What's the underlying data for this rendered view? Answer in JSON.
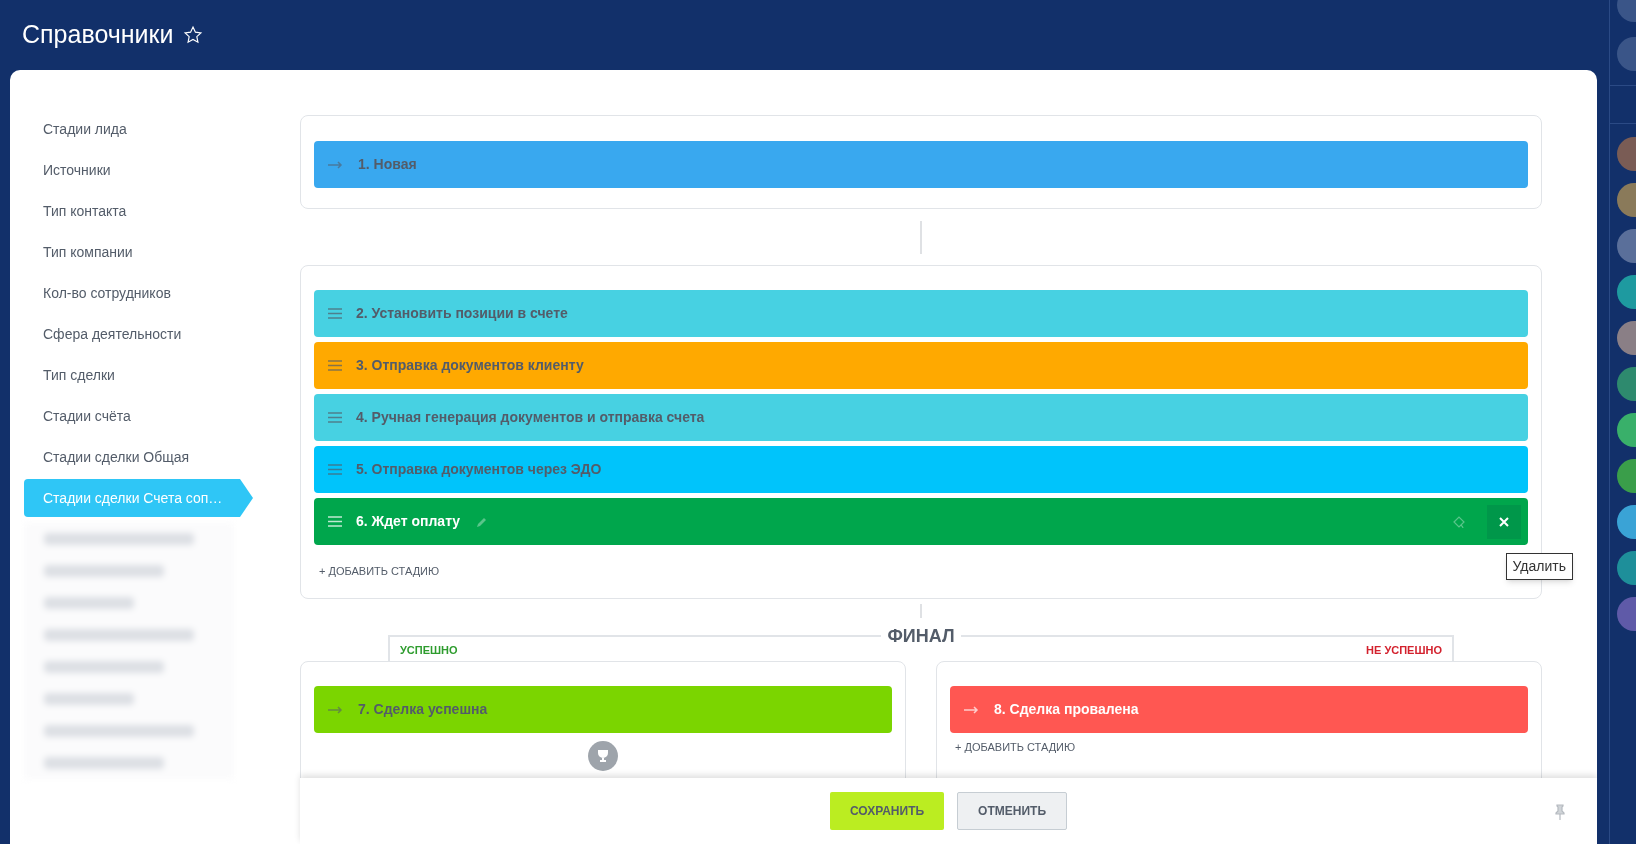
{
  "header": {
    "title": "Справочники",
    "favorite": false
  },
  "sidebar": {
    "items": [
      {
        "label": "Стадии лида",
        "selected": false
      },
      {
        "label": "Источники",
        "selected": false
      },
      {
        "label": "Тип контакта",
        "selected": false
      },
      {
        "label": "Тип компании",
        "selected": false
      },
      {
        "label": "Кол-во сотрудников",
        "selected": false
      },
      {
        "label": "Сфера деятельности",
        "selected": false
      },
      {
        "label": "Тип сделки",
        "selected": false
      },
      {
        "label": "Стадии счёта",
        "selected": false
      },
      {
        "label": "Стадии сделки Общая",
        "selected": false
      },
      {
        "label": "Стадии сделки Счета соп…",
        "selected": true
      }
    ]
  },
  "start_stage": {
    "label": "1. Новая",
    "color": "#39a8ef",
    "kind": "fixed",
    "active": false
  },
  "stages": [
    {
      "label": "2. Установить позиции в счете",
      "color": "#47d1e2",
      "kind": "sortable",
      "active": false
    },
    {
      "label": "3. Отправка документов клиенту",
      "color": "#ffa900",
      "kind": "sortable",
      "active": false
    },
    {
      "label": "4. Ручная генерация документов и отправка счета",
      "color": "#47d1e2",
      "kind": "sortable",
      "active": false
    },
    {
      "label": "5. Отправка документов через ЭДО",
      "color": "#00c4fb",
      "kind": "sortable",
      "active": false
    },
    {
      "label": "6. Ждет оплату",
      "color": "#00a64c",
      "kind": "sortable",
      "active": true
    }
  ],
  "tooltip": "Удалить",
  "add_stage": "+ ДОБАВИТЬ СТАДИЮ",
  "final": {
    "title": "ФИНАЛ",
    "success": {
      "label": "УСПЕШНО",
      "stage": {
        "label": "7. Сделка успешна",
        "color": "#7bd500",
        "kind": "fixed",
        "active": false
      }
    },
    "failure": {
      "label": "НЕ УСПЕШНО",
      "stage": {
        "label": "8. Сделка провалена",
        "color": "#ff5752",
        "kind": "fixed",
        "active": false
      },
      "add_stage": "+ ДОБАВИТЬ СТАДИЮ"
    }
  },
  "footer": {
    "buttons": [
      {
        "label": "СОХРАНИТЬ",
        "kind": "primary"
      },
      {
        "label": "ОТМЕНИТЬ",
        "kind": "secondary"
      }
    ]
  },
  "avatars": [
    {
      "color": "#7a5c55"
    },
    {
      "color": "#8a7a5a"
    },
    {
      "color": "#5a6f9a"
    },
    {
      "color": "#1e9aa0"
    },
    {
      "color": "#8a7f86"
    },
    {
      "color": "#2e8a6e"
    },
    {
      "color": "#39b06a"
    },
    {
      "color": "#3a9e4a"
    },
    {
      "color": "#3aa3d6"
    },
    {
      "color": "#1e8f9a"
    },
    {
      "color": "#5f5aa8"
    }
  ]
}
